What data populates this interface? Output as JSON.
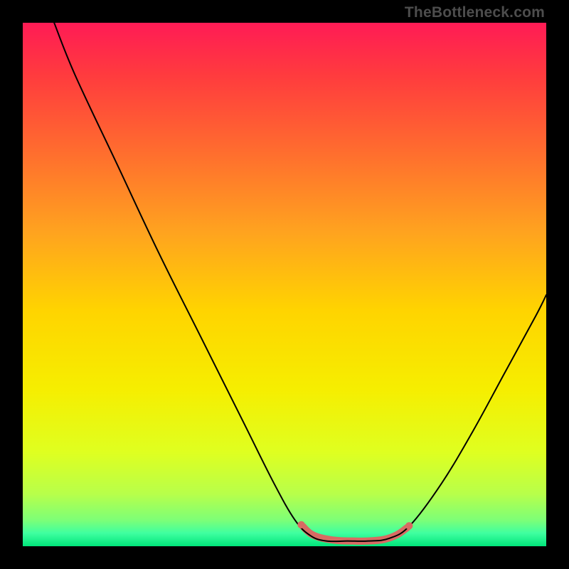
{
  "watermark": "TheBottleneck.com",
  "chart_data": {
    "type": "line",
    "title": "",
    "xlabel": "",
    "ylabel": "",
    "xlim": [
      0,
      100
    ],
    "ylim": [
      0,
      100
    ],
    "grid": false,
    "legend": false,
    "gradient_stops": [
      {
        "offset": 0.0,
        "color": "#ff1b55"
      },
      {
        "offset": 0.1,
        "color": "#ff3b3e"
      },
      {
        "offset": 0.25,
        "color": "#ff6e2e"
      },
      {
        "offset": 0.4,
        "color": "#ffa31f"
      },
      {
        "offset": 0.55,
        "color": "#ffd400"
      },
      {
        "offset": 0.7,
        "color": "#f6ee00"
      },
      {
        "offset": 0.82,
        "color": "#dfff20"
      },
      {
        "offset": 0.9,
        "color": "#b8ff4a"
      },
      {
        "offset": 0.95,
        "color": "#7dff77"
      },
      {
        "offset": 0.975,
        "color": "#3fffa0"
      },
      {
        "offset": 1.0,
        "color": "#00e57a"
      }
    ],
    "series": [
      {
        "name": "curve",
        "color": "#000000",
        "stroke_width": 2,
        "points": [
          {
            "x": 6.0,
            "y": 100.0
          },
          {
            "x": 10.0,
            "y": 90.0
          },
          {
            "x": 18.0,
            "y": 73.0
          },
          {
            "x": 26.0,
            "y": 56.0
          },
          {
            "x": 34.0,
            "y": 40.0
          },
          {
            "x": 42.0,
            "y": 24.0
          },
          {
            "x": 48.0,
            "y": 12.0
          },
          {
            "x": 52.0,
            "y": 5.0
          },
          {
            "x": 55.0,
            "y": 2.0
          },
          {
            "x": 58.0,
            "y": 1.0
          },
          {
            "x": 62.0,
            "y": 1.0
          },
          {
            "x": 66.0,
            "y": 1.0
          },
          {
            "x": 70.0,
            "y": 1.5
          },
          {
            "x": 74.0,
            "y": 4.0
          },
          {
            "x": 80.0,
            "y": 12.0
          },
          {
            "x": 86.0,
            "y": 22.0
          },
          {
            "x": 92.0,
            "y": 33.0
          },
          {
            "x": 98.0,
            "y": 44.0
          },
          {
            "x": 100.0,
            "y": 48.0
          }
        ]
      }
    ],
    "highlight_segments": [
      {
        "name": "valley-highlight",
        "color": "#d86a63",
        "stroke_width": 10,
        "points": [
          {
            "x": 53.5,
            "y": 3.8
          },
          {
            "x": 55.0,
            "y": 2.4
          },
          {
            "x": 57.0,
            "y": 1.6
          },
          {
            "x": 60.0,
            "y": 1.1
          },
          {
            "x": 63.0,
            "y": 1.0
          },
          {
            "x": 66.0,
            "y": 1.0
          },
          {
            "x": 69.0,
            "y": 1.3
          },
          {
            "x": 71.5,
            "y": 2.2
          },
          {
            "x": 73.5,
            "y": 3.6
          }
        ]
      }
    ],
    "highlight_dots": [
      {
        "x": 53.2,
        "y": 4.1,
        "r": 5.2,
        "color": "#d86a63"
      },
      {
        "x": 73.8,
        "y": 3.9,
        "r": 5.2,
        "color": "#d86a63"
      }
    ]
  }
}
